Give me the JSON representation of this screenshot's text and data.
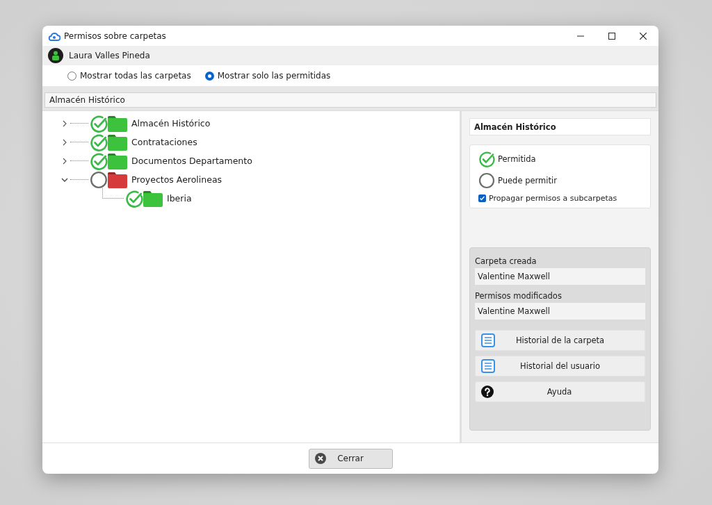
{
  "window": {
    "title": "Permisos sobre carpetas"
  },
  "user": {
    "name": "Laura Valles Pineda"
  },
  "view_options": [
    {
      "label": "Mostrar todas las carpetas",
      "selected": false
    },
    {
      "label": "Mostrar solo las permitidas",
      "selected": true
    }
  ],
  "path": "Almacén Histórico",
  "tree": [
    {
      "label": "Almacén Histórico",
      "kind": "allowed",
      "color": "#3cc23c",
      "expanded": false
    },
    {
      "label": "Contrataciones",
      "kind": "allowed",
      "color": "#3cc23c",
      "expanded": false
    },
    {
      "label": "Documentos Departamento",
      "kind": "allowed",
      "color": "#3cc23c",
      "expanded": false
    },
    {
      "label": "Proyectos Aerolineas",
      "kind": "possible",
      "color": "#d63a3a",
      "expanded": true,
      "children": [
        {
          "label": "Iberia",
          "kind": "allowed",
          "color": "#3cc23c"
        }
      ]
    }
  ],
  "details": {
    "title": "Almacén Histórico",
    "legend": [
      {
        "kind": "allowed",
        "label": "Permitida"
      },
      {
        "kind": "possible",
        "label": "Puede permitir"
      }
    ],
    "propagate": {
      "label": "Propagar permisos a subcarpetas",
      "checked": true
    },
    "fields": [
      {
        "label": "Carpeta creada",
        "value": "Valentine Maxwell"
      },
      {
        "label": "Permisos modificados",
        "value": "Valentine Maxwell"
      }
    ],
    "buttons": [
      {
        "kind": "document",
        "label": "Historial de la carpeta"
      },
      {
        "kind": "document",
        "label": "Historial del usuario"
      },
      {
        "kind": "help",
        "label": "Ayuda"
      }
    ]
  },
  "footer": {
    "close_button": "Cerrar"
  }
}
